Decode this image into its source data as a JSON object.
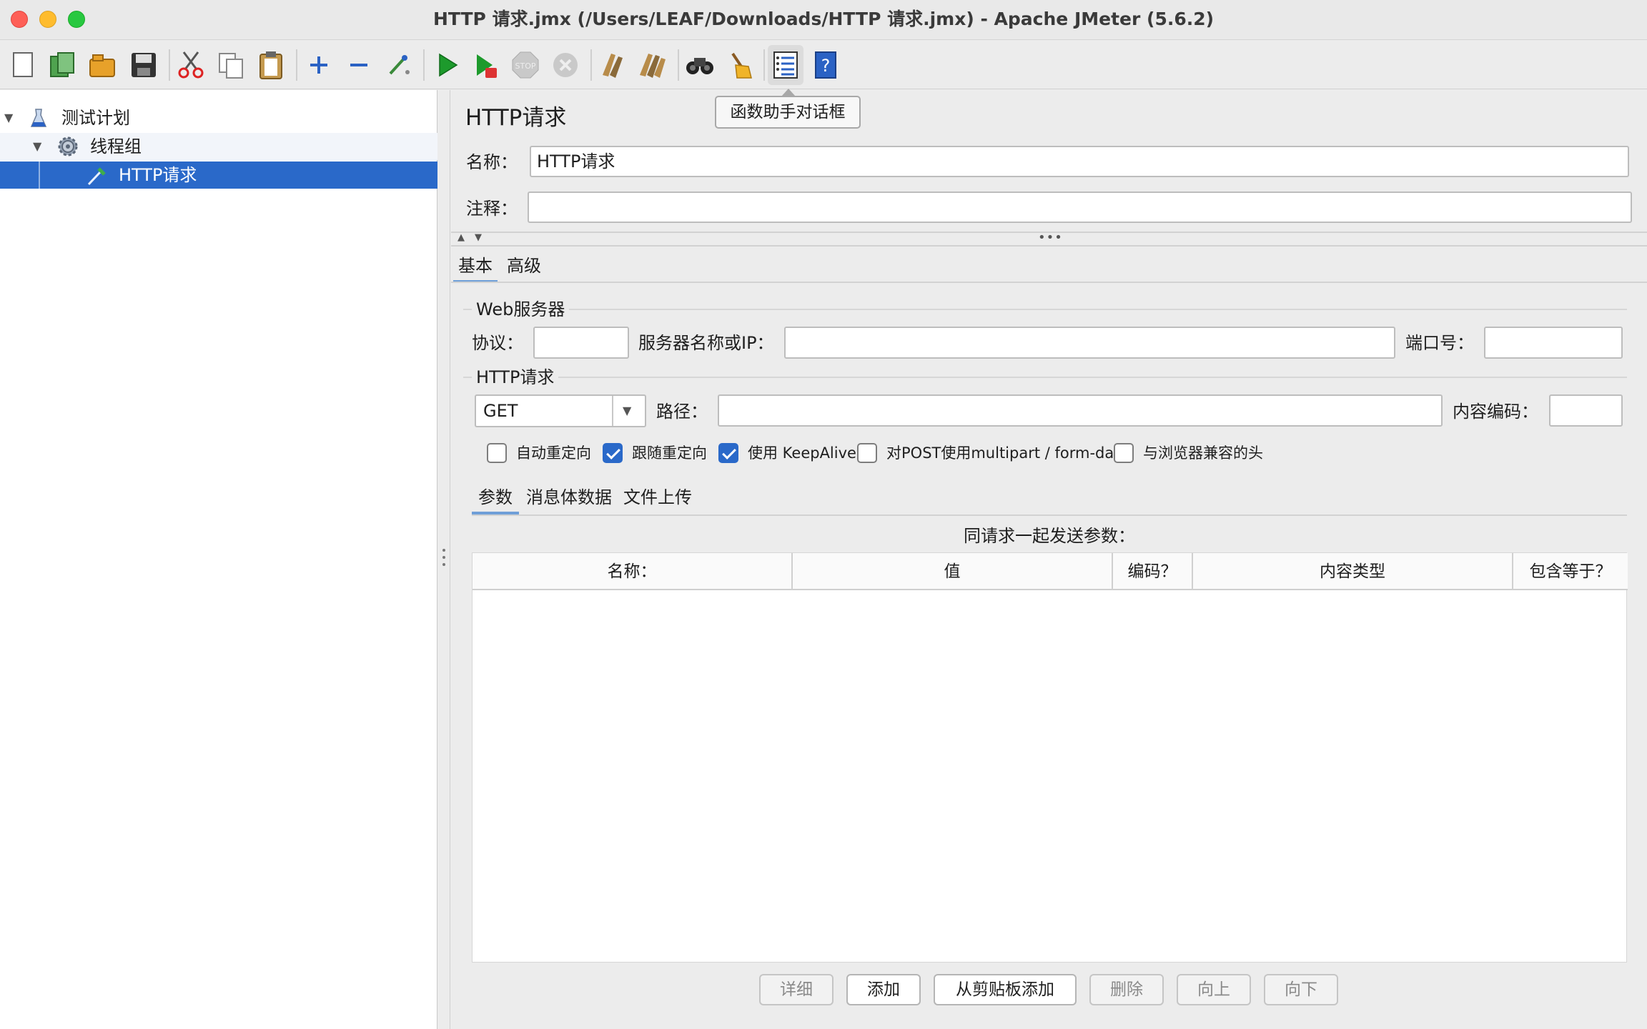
{
  "window": {
    "title": "HTTP 请求.jmx (/Users/LEAF/Downloads/HTTP 请求.jmx) - Apache JMeter (5.6.2)",
    "traffic_lights": {
      "close": "#fe5f57",
      "minimize": "#febc2e",
      "zoom": "#28c840"
    }
  },
  "toolbar": {
    "icons": [
      "new-icon",
      "templates-icon",
      "open-icon",
      "save-icon",
      "cut-icon",
      "copy-icon",
      "paste-icon",
      "expand-icon",
      "collapse-icon",
      "toggle-icon",
      "start-icon",
      "start-no-pauses-icon",
      "stop-icon",
      "shutdown-icon",
      "clear-icon",
      "clear-all-icon",
      "search-icon",
      "reset-search-icon",
      "function-helper-icon",
      "help-icon"
    ],
    "tooltip": "函数助手对话框"
  },
  "tree": {
    "items": [
      {
        "label": "测试计划",
        "level": 0,
        "expanded": true,
        "icon": "flask-icon"
      },
      {
        "label": "线程组",
        "level": 1,
        "expanded": true,
        "icon": "gear-icon"
      },
      {
        "label": "HTTP请求",
        "level": 2,
        "selected": true,
        "icon": "pipette-icon"
      }
    ]
  },
  "panel": {
    "heading": "HTTP请求",
    "name_label": "名称：",
    "name_value": "HTTP请求",
    "comment_label": "注释：",
    "comment_value": "",
    "tabs": [
      "基本",
      "高级"
    ],
    "active_tab": "基本",
    "web_server": {
      "section": "Web服务器",
      "protocol_label": "协议：",
      "protocol_value": "",
      "server_label": "服务器名称或IP：",
      "server_value": "",
      "port_label": "端口号：",
      "port_value": ""
    },
    "http_request": {
      "section": "HTTP请求",
      "method": "GET",
      "path_label": "路径：",
      "path_value": "",
      "encoding_label": "内容编码：",
      "encoding_value": ""
    },
    "checkboxes": [
      {
        "label": "自动重定向",
        "checked": false
      },
      {
        "label": "跟随重定向",
        "checked": true
      },
      {
        "label": "使用 KeepAlive",
        "checked": true
      },
      {
        "label": "对POST使用multipart / form-data",
        "checked": false
      },
      {
        "label": "与浏览器兼容的头",
        "checked": false
      }
    ],
    "sub_tabs": [
      "参数",
      "消息体数据",
      "文件上传"
    ],
    "active_sub_tab": "参数",
    "params_caption": "同请求一起发送参数：",
    "table_headers": [
      "名称：",
      "值",
      "编码？",
      "内容类型",
      "包含等于？"
    ],
    "table_rows": [],
    "buttons": [
      {
        "label": "详细",
        "enabled": false
      },
      {
        "label": "添加",
        "enabled": true
      },
      {
        "label": "从剪贴板添加",
        "enabled": true
      },
      {
        "label": "删除",
        "enabled": false
      },
      {
        "label": "向上",
        "enabled": false
      },
      {
        "label": "向下",
        "enabled": false
      }
    ]
  },
  "colors": {
    "selection": "#2a69c9",
    "accent_tab": "#6f9fd8"
  }
}
